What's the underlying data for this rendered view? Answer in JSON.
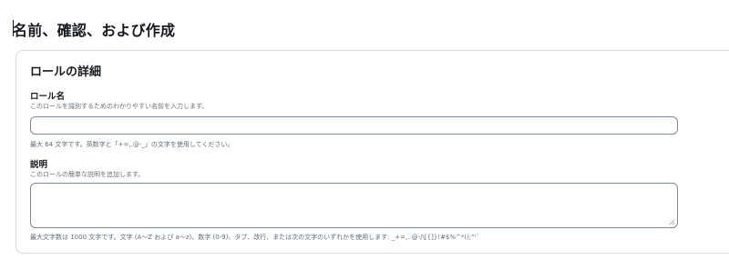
{
  "page": {
    "title": "名前、確認、および作成"
  },
  "role_details": {
    "heading": "ロールの詳細",
    "role_name": {
      "label": "ロール名",
      "description": "このロールを識別するためのわかりやすい名前を入力します。",
      "value": "",
      "hint": "最大 64 文字です。英数字と「+=,.@-_」の文字を使用してください。"
    },
    "description_field": {
      "label": "説明",
      "description": "このロールの簡単な説明を追加します。",
      "value": "",
      "hint": "最大文字数は 1000 文字です。文字 (A〜Z および a〜z)、数字 (0-9)、タブ、改行、または次の文字のいずれかを使用します: _+=,. @-/\\[{]}!#$%^*();\"'`"
    }
  }
}
